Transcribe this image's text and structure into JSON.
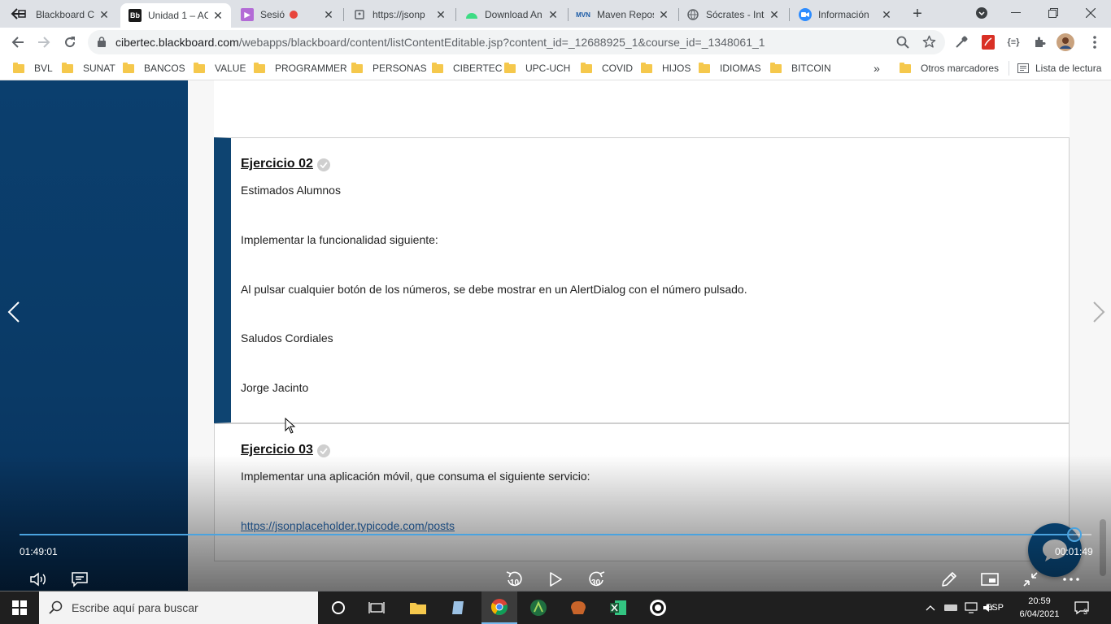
{
  "browser": {
    "tabs": [
      {
        "title": "Blackboard C",
        "favicon": "back-arrow-icon",
        "active": false
      },
      {
        "title": "Unidad 1 – AC",
        "favicon": "blackboard-icon",
        "active": true
      },
      {
        "title": "Sesión – T",
        "favicon": "video-icon",
        "active": false
      },
      {
        "title": "https://jsonp",
        "favicon": "page-icon",
        "active": false
      },
      {
        "title": "Download An",
        "favicon": "android-icon",
        "active": false
      },
      {
        "title": "Maven Repos",
        "favicon": "maven-icon",
        "active": false
      },
      {
        "title": "Sócrates - Intr",
        "favicon": "globe-icon",
        "active": false
      },
      {
        "title": "Información",
        "favicon": "zoom-icon",
        "active": false
      }
    ],
    "url": {
      "host": "cibertec.blackboard.com",
      "path": "/webapps/blackboard/content/listContentEditable.jsp?content_id=_12688925_1&course_id=_1348061_1"
    },
    "bookmarks": [
      "BVL",
      "SUNAT",
      "BANCOS",
      "VALUE",
      "PROGRAMMER",
      "PERSONAS",
      "CIBERTEC",
      "UPC-UCH",
      "COVID",
      "HIJOS",
      "IDIOMAS",
      "BITCOIN"
    ],
    "bookmarks_more": "»",
    "other_bookmarks": "Otros marcadores",
    "reading_list": "Lista de lectura"
  },
  "content": {
    "items": [
      {
        "title": "Ejercicio 02",
        "paragraphs": [
          "Estimados Alumnos",
          "Implementar la funcionalidad siguiente:",
          "Al pulsar cualquier botón de los números, se debe mostrar en un AlertDialog con el número pulsado.",
          "Saludos Cordiales",
          "Jorge Jacinto"
        ]
      },
      {
        "title": "Ejercicio 03",
        "paragraphs": [
          "Implementar una aplicación móvil, que consuma el siguiente servicio:"
        ],
        "link": "https://jsonplaceholder.typicode.com/posts"
      }
    ]
  },
  "video": {
    "elapsed": "01:49:01",
    "remaining": "00:01:49",
    "progress": 0.983,
    "rewind_seconds": "10",
    "forward_seconds": "30"
  },
  "taskbar": {
    "search_placeholder": "Escribe aquí para buscar",
    "language": "ESP",
    "time": "20:59",
    "date": "6/04/2021",
    "notification_count": "3"
  },
  "colors": {
    "sidebar": "#0b3f6e",
    "active_marker": "#0e4471",
    "link": "#2a6ab0",
    "progress": "#4aa3df",
    "fab": "#0a5795"
  }
}
